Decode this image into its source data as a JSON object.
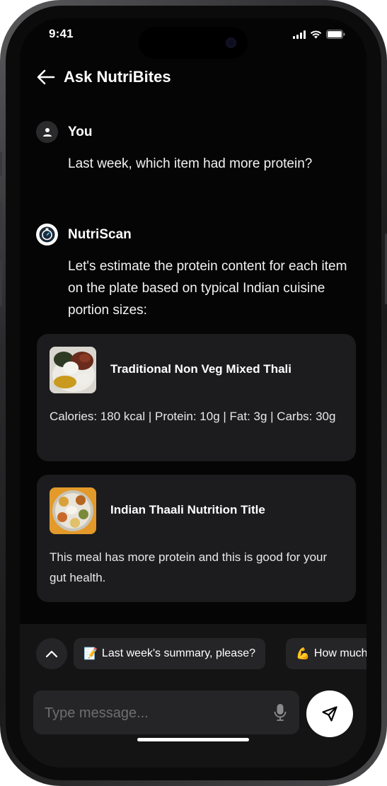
{
  "status": {
    "time": "9:41"
  },
  "header": {
    "title": "Ask NutriBites",
    "back_icon": "arrow-left-icon"
  },
  "conversation": {
    "user_message": {
      "sender": "You",
      "text": "Last week, which item had more protein?"
    },
    "bot_message": {
      "sender": "NutriScan",
      "text": "Let's estimate the protein content for each item on the plate based on typical Indian cuisine portion sizes:"
    },
    "cards": [
      {
        "title": "Traditional Non Veg Mixed Thali",
        "body": "Calories: 180 kcal | Protein: 10g | Fat: 3g | Carbs: 30g"
      },
      {
        "title": "Indian Thaali Nutrition Title",
        "body": "This meal has more protein and this is good for your gut health."
      }
    ]
  },
  "suggestions": [
    {
      "emoji": "📝",
      "label": "Last week's summary, please?"
    },
    {
      "emoji": "💪",
      "label": "How much protein did I have?"
    }
  ],
  "composer": {
    "placeholder": "Type message..."
  },
  "colors": {
    "background": "#050505",
    "card": "#1c1c1e",
    "accent": "#ffffff"
  }
}
